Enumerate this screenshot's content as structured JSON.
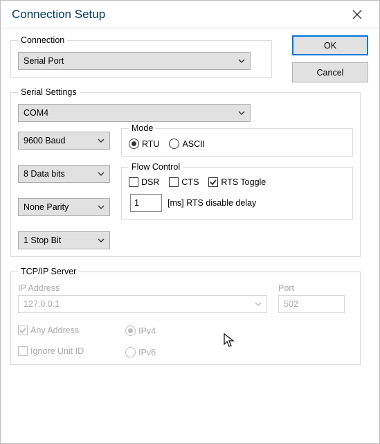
{
  "window": {
    "title": "Connection Setup"
  },
  "buttons": {
    "ok": "OK",
    "cancel": "Cancel"
  },
  "connection": {
    "legend": "Connection",
    "type": "Serial Port"
  },
  "serial": {
    "legend": "Serial Settings",
    "port": "COM4",
    "baud": "9600 Baud",
    "data_bits": "8 Data bits",
    "parity": "None Parity",
    "stop_bits": "1 Stop Bit",
    "mode": {
      "legend": "Mode",
      "rtu": "RTU",
      "ascii": "ASCII",
      "selected": "RTU"
    },
    "flow": {
      "legend": "Flow Control",
      "dsr": "DSR",
      "cts": "CTS",
      "rts_toggle": "RTS Toggle",
      "dsr_checked": false,
      "cts_checked": false,
      "rts_checked": true,
      "delay_value": "1",
      "delay_label": "[ms] RTS disable delay"
    }
  },
  "tcp": {
    "legend": "TCP/IP Server",
    "ip_label": "IP Address",
    "ip_value": "127.0.0.1",
    "port_label": "Port",
    "port_value": "502",
    "any_address": "Any Address",
    "ignore_unit": "Ignore Unit ID",
    "ipv4": "IPv4",
    "ipv6": "IPv6",
    "any_checked": true,
    "ignore_checked": false,
    "ip_version": "IPv4"
  }
}
